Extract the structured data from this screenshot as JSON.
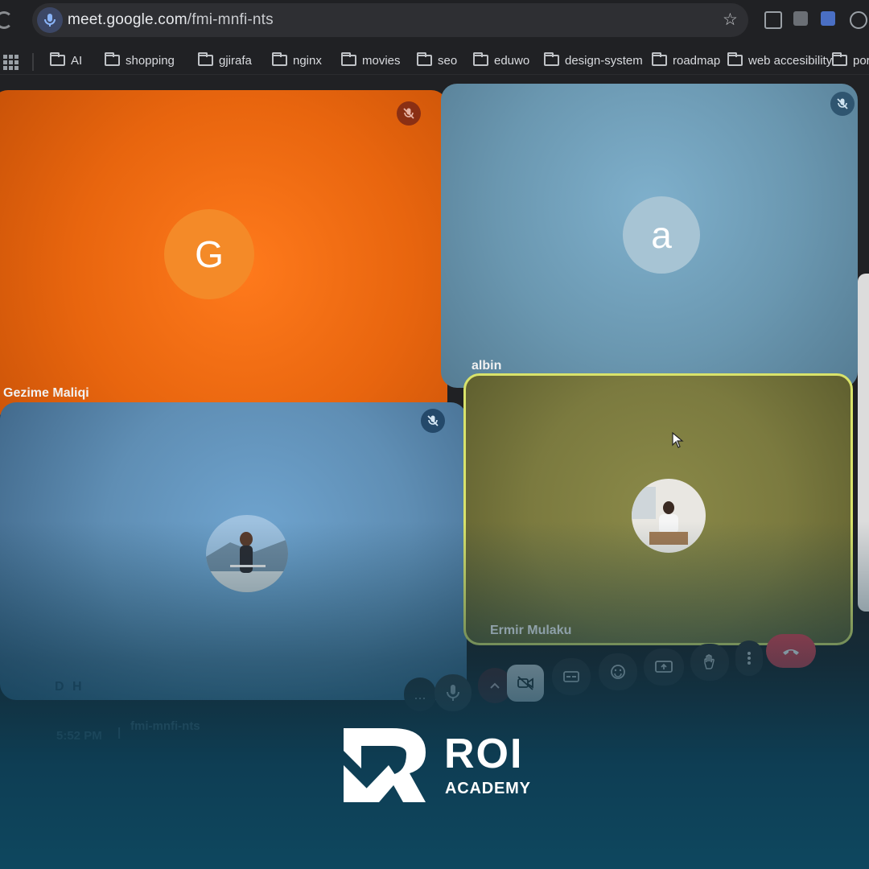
{
  "browser": {
    "url_host": "meet.google.com",
    "url_path": "/fmi-mnfi-nts",
    "bookmarks": [
      "AI",
      "shopping",
      "gjirafa",
      "nginx",
      "movies",
      "seo",
      "eduwo",
      "design-system",
      "roadmap",
      "web accesibility",
      "porf"
    ]
  },
  "meeting": {
    "participants": [
      {
        "name": "Gezime Maliqi",
        "initial": "G",
        "muted": true,
        "tile_color": "#e8650e"
      },
      {
        "name": "albin",
        "initial": "a",
        "muted": true,
        "tile_color": "#6a97b0"
      },
      {
        "name": "D H",
        "initial": "",
        "muted": true,
        "tile_color": "#5f8eb4"
      },
      {
        "name": "Ermir Mulaku",
        "initial": "",
        "muted": false,
        "tile_color": "#7b7a3f",
        "speaking": true
      }
    ],
    "time": "5:52 PM",
    "separator": "|",
    "code": "fmi-mnfi-nts",
    "more_label": "..."
  },
  "brand": {
    "title": "ROI",
    "subtitle": "ACADEMY"
  },
  "colors": {
    "accent_red": "#e0424f",
    "speaking_outline": "#d9e36a"
  },
  "icons": [
    "mic-off-icon",
    "camera-off-icon",
    "captions-icon",
    "emoji-icon",
    "present-icon",
    "raise-hand-icon",
    "more-vert-icon",
    "hangup-icon",
    "star-icon",
    "folder-icon"
  ]
}
